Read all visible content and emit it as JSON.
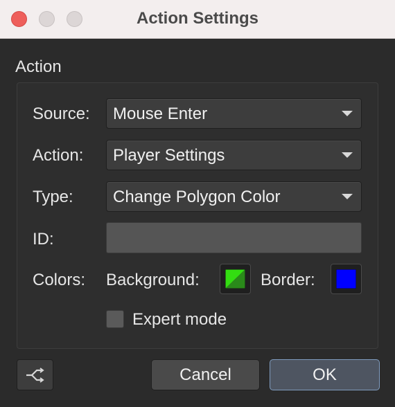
{
  "window": {
    "title": "Action Settings"
  },
  "section": {
    "label": "Action"
  },
  "form": {
    "source": {
      "label": "Source:",
      "value": "Mouse Enter"
    },
    "action": {
      "label": "Action:",
      "value": "Player Settings"
    },
    "type": {
      "label": "Type:",
      "value": "Change Polygon Color"
    },
    "id": {
      "label": "ID:",
      "value": ""
    },
    "colors": {
      "label": "Colors:",
      "background_label": "Background:",
      "background_colors": [
        "#33dd11",
        "#2a8a1a"
      ],
      "border_label": "Border:",
      "border_color": "#0000ff"
    },
    "expert_mode": {
      "label": "Expert mode",
      "checked": false
    }
  },
  "footer": {
    "icon": "route-icon",
    "cancel_label": "Cancel",
    "ok_label": "OK"
  }
}
